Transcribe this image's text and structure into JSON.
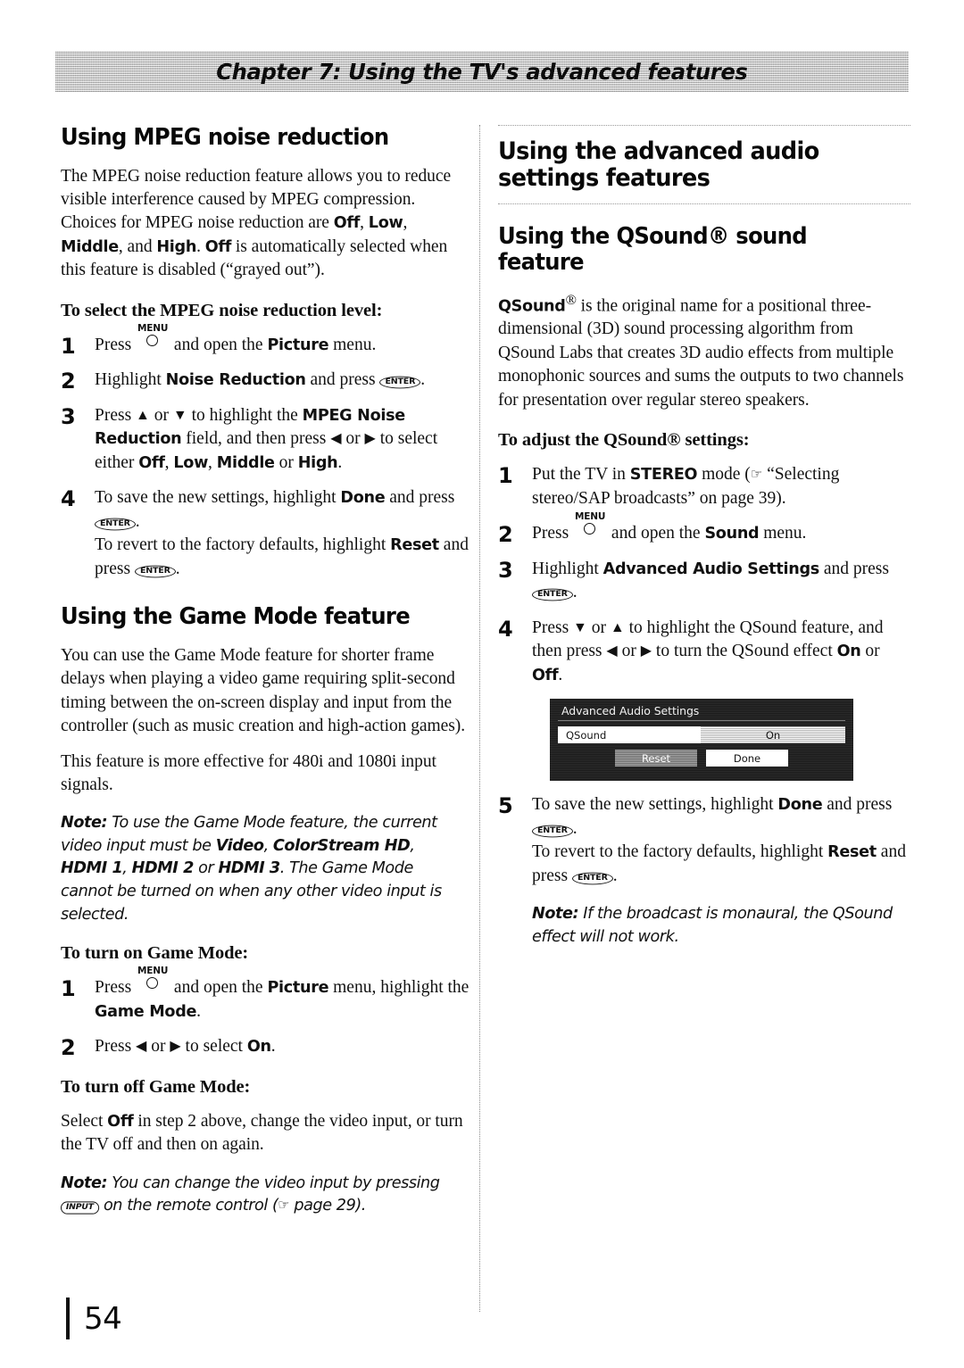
{
  "header": {
    "chapter_banner": "Chapter 7: Using the TV's advanced features"
  },
  "page": {
    "number": "54"
  },
  "left_column": {
    "section1": {
      "heading": "Using MPEG noise reduction",
      "intro_part1": "The MPEG noise reduction feature allows you to reduce visible interference caused by MPEG compression. Choices for MPEG noise reduction are ",
      "intro_opt_off": "Off",
      "intro_sep1": ", ",
      "intro_opt_low": "Low",
      "intro_sep2": ", ",
      "intro_opt_middle": "Middle",
      "intro_sep3": ", and ",
      "intro_opt_high": "High",
      "intro_sep4": ". ",
      "intro_opt_off2": "Off",
      "intro_part2": " is automatically selected when this feature is disabled (“grayed out”).",
      "procedure_title": "To select the MPEG noise reduction level:",
      "step1": {
        "num": "1",
        "text_before": "Press",
        "menu_label": "MENU",
        "text_mid": "and open the ",
        "bold1": "Picture",
        "text_after": " menu."
      },
      "step2": {
        "num": "2",
        "text_before": "Highlight ",
        "bold1": "Noise Reduction",
        "text_mid": " and press ",
        "enter_label": "ENTER",
        "text_after": "."
      },
      "step3": {
        "num": "3",
        "text_before": "Press ",
        "arrow_up": "▲",
        "text_or1": " or ",
        "arrow_down": "▼",
        "text_mid1": " to highlight the ",
        "bold1": "MPEG Noise Reduction",
        "text_mid2": " field, and then press ",
        "arrow_left": "◀",
        "text_or2": " or ",
        "arrow_right": "▶",
        "text_mid3": " to select either ",
        "opt_off": "Off",
        "sep1": ", ",
        "opt_low": "Low",
        "sep2": ", ",
        "opt_middle": "Middle",
        "sep3": " or ",
        "opt_high": "High",
        "text_end": "."
      },
      "step4": {
        "num": "4",
        "line1_before": "To save the new settings, highlight ",
        "line1_bold": "Done",
        "line1_mid": " and press ",
        "enter_label": "ENTER",
        "line1_end": ".",
        "line2_before": "To revert to the factory defaults, highlight ",
        "line2_bold": "Reset",
        "line2_mid": " and press ",
        "enter_label2": "ENTER",
        "line2_end": "."
      }
    },
    "section2": {
      "heading": "Using the Game Mode feature",
      "para1": "You can use the Game Mode feature for shorter frame delays when playing a video game requiring split-second timing between the on-screen display and input from the controller (such as music creation and high-action games).",
      "para2": "This feature is more effective for 480i and 1080i input signals.",
      "note1": {
        "label": "Note:",
        "text1": " To use the Game Mode feature, the current video input must be ",
        "bold1": "Video",
        "sep1": ", ",
        "bold2": "ColorStream HD",
        "sep2": ", ",
        "bold3": "HDMI 1",
        "sep3": ", ",
        "bold4": "HDMI 2",
        "sep4": " or ",
        "bold5": "HDMI 3",
        "text2": ". The Game Mode cannot be turned on when any other video input is selected."
      },
      "turn_on_title": "To turn on Game Mode:",
      "on_step1": {
        "num": "1",
        "text_before": "Press",
        "menu_label": "MENU",
        "text_mid": "and open the ",
        "bold1": "Picture",
        "text_mid2": " menu, highlight the ",
        "bold2": "Game Mode",
        "text_end": "."
      },
      "on_step2": {
        "num": "2",
        "text_before": "Press ",
        "arrow_left": "◀",
        "text_or": " or ",
        "arrow_right": "▶",
        "text_mid": " to select ",
        "bold1": "On",
        "text_end": "."
      },
      "turn_off_title": "To turn off Game Mode:",
      "off_para_before": "Select ",
      "off_para_bold": "Off",
      "off_para_after": " in step 2 above, change the video input, or turn the TV off and then on again.",
      "note2": {
        "label": "Note:",
        "text1": " You can change the video input by pressing ",
        "input_label": "INPUT",
        "text2": " on the remote control (",
        "hand": "☞",
        "text3": " page 29)."
      }
    }
  },
  "right_column": {
    "major_heading": "Using the advanced audio settings features",
    "section1": {
      "heading": "Using the QSound® sound feature",
      "intro_bold": "QSound",
      "intro_sup": "®",
      "intro_text": " is the original name for a positional three-dimensional (3D) sound processing algorithm from QSound Labs that creates 3D audio effects from multiple monophonic sources and sums the outputs to two channels for presentation over regular stereo speakers.",
      "procedure_title": "To adjust the QSound® settings:",
      "step1": {
        "num": "1",
        "text_before": "Put the TV in ",
        "bold1": "STEREO",
        "text_mid": " mode (",
        "hand": "☞",
        "text_after": " “Selecting stereo/SAP broadcasts” on page 39)."
      },
      "step2": {
        "num": "2",
        "text_before": "Press",
        "menu_label": "MENU",
        "text_mid": "and open the ",
        "bold1": "Sound",
        "text_after": " menu."
      },
      "step3": {
        "num": "3",
        "text_before": "Highlight ",
        "bold1": "Advanced Audio Settings",
        "text_mid": " and press ",
        "enter_label": "ENTER",
        "text_after": "."
      },
      "step4": {
        "num": "4",
        "text_before": "Press ",
        "arrow_down": "▼",
        "text_or1": " or ",
        "arrow_up": "▲",
        "text_mid1": " to highlight the QSound feature, and then press ",
        "arrow_left": "◀",
        "text_or2": " or ",
        "arrow_right": "▶",
        "text_mid2": " to turn the QSound effect ",
        "bold_on": "On",
        "text_or3": " or ",
        "bold_off": "Off",
        "text_end": "."
      },
      "tv_menu": {
        "title": "Advanced Audio Settings",
        "field_label": "QSound",
        "field_value": "On",
        "button_reset": "Reset",
        "button_done": "Done"
      },
      "step5": {
        "num": "5",
        "line1_before": "To save the new settings, highlight ",
        "line1_bold": "Done",
        "line1_mid": " and press ",
        "enter_label": "ENTER",
        "line1_end": ".",
        "line2_before": "To revert to the factory defaults, highlight ",
        "line2_bold": "Reset",
        "line2_mid": " and press ",
        "enter_label2": "ENTER",
        "line2_end": "."
      },
      "note": {
        "label": "Note:",
        "text": " If the broadcast is monaural, the QSound effect will not work."
      }
    }
  }
}
